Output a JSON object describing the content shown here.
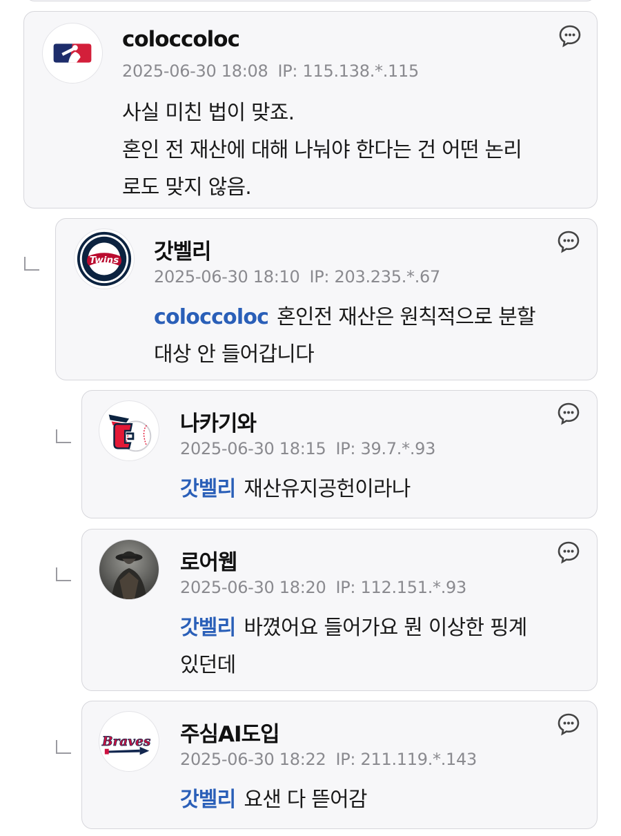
{
  "comments": [
    {
      "nickname": "coloccoloc",
      "date": "2025-06-30 18:08",
      "ip": "IP: 115.138.*.115",
      "avatar_icon": "mlb-logo-icon",
      "mention": "",
      "lines": [
        "사실 미친 법이 맞죠.",
        "혼인 전 재산에 대해 나눠야 한다는 건 어떤 논리",
        "로도 맞지 않음."
      ]
    },
    {
      "nickname": "갓벨리",
      "date": "2025-06-30 18:10",
      "ip": "IP: 203.235.*.67",
      "avatar_icon": "twins-logo-icon",
      "mention": "coloccoloc",
      "lines": [
        "혼인전 재산은 원칙적으로 분할",
        "대상 안 들어갑니다"
      ]
    },
    {
      "nickname": "나카기와",
      "date": "2025-06-30 18:15",
      "ip": "IP: 39.7.*.93",
      "avatar_icon": "guardians-logo-icon",
      "mention": "갓벨리",
      "lines": [
        "재산유지공헌이라나"
      ]
    },
    {
      "nickname": "로어웹",
      "date": "2025-06-30 18:20",
      "ip": "IP: 112.151.*.93",
      "avatar_icon": "profile-photo-icon",
      "mention": "갓벨리",
      "lines": [
        "바꼈어요 들어가요 뭔 이상한 핑계",
        "있던데"
      ]
    },
    {
      "nickname": "주심AI도입",
      "date": "2025-06-30 18:22",
      "ip": "IP: 211.119.*.143",
      "avatar_icon": "braves-logo-icon",
      "mention": "갓벨리",
      "lines": [
        "요샌 다 뜯어감"
      ]
    }
  ],
  "colors": {
    "card_bg": "#f7f7f9",
    "card_border": "#d6d6db",
    "mention": "#2a5fb8",
    "meta": "#8a8a8f"
  }
}
